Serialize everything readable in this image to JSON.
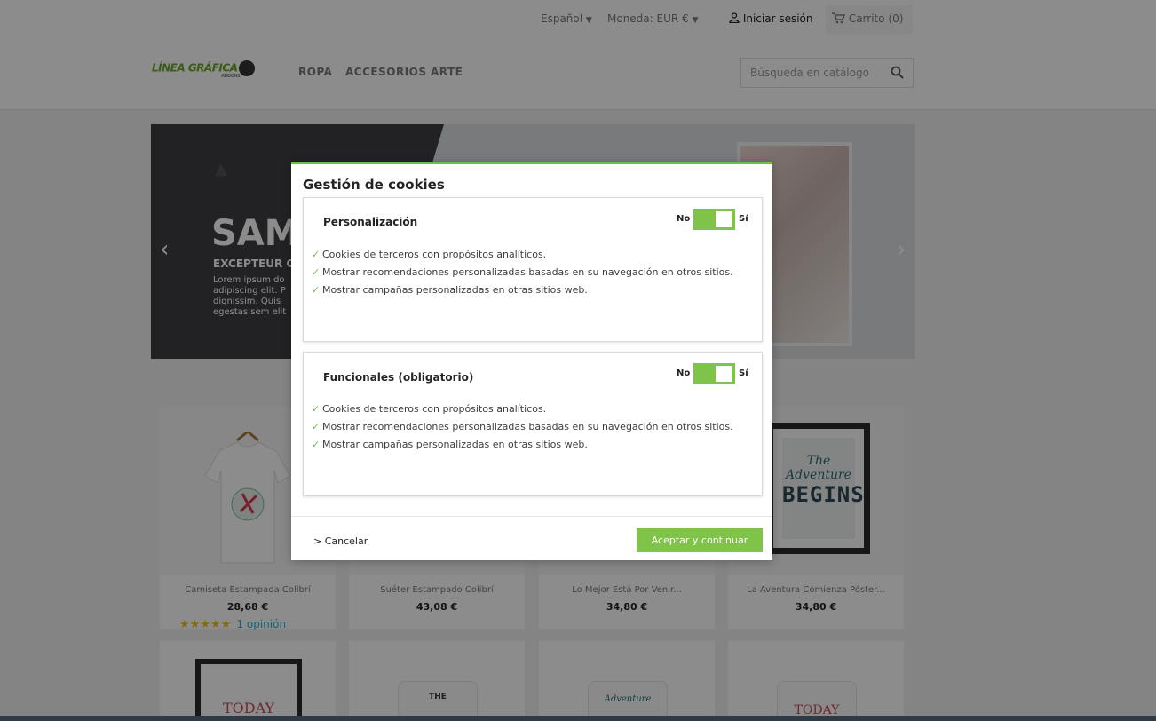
{
  "header": {
    "language": "Español",
    "currency": "Moneda: EUR €",
    "sign_in": "Iniciar sesión",
    "cart": "Carrito (0)",
    "logo_text": "LÍNEA GRÁFICA",
    "logo_small": "ADDONS",
    "menu": [
      "ROPA",
      "ACCESORIOS",
      "ARTE"
    ],
    "search_placeholder": "Búsqueda en catálogo"
  },
  "hero": {
    "title": "SAM",
    "subtitle": "EXCEPTEUR C",
    "text": "Lorem ipsum do adipiscing elit. P dignissim. Quis egestas sem elit"
  },
  "products": [
    {
      "name": "Camiseta Estampada Colibrí",
      "price": "28,68 €",
      "rating": 5,
      "reviews": "1 opinión"
    },
    {
      "name": "Suéter Estampado Colibrí",
      "price": "43,08 €"
    },
    {
      "name": "Lo Mejor Está Por Venir...",
      "price": "34,80 €"
    },
    {
      "name": "La Aventura Comienza Póster...",
      "price": "34,80 €"
    }
  ],
  "row2_labels": [
    "TODAY",
    "THE",
    "Adventure",
    "TODAY"
  ],
  "poster_text": {
    "small": "The Adventure",
    "big": "BEGINS"
  },
  "modal": {
    "title": "Gestión de cookies",
    "sections": [
      {
        "title": "Personalización",
        "toggle_no": "No",
        "toggle_yes": "Sí",
        "enabled": true,
        "items": [
          "Cookies de terceros con propósitos analíticos.",
          "Mostrar recomendaciones personalizadas basadas en su navegación en otros sitios.",
          "Mostrar campañas personalizadas en otras sitios web."
        ]
      },
      {
        "title": "Funcionales (obligatorio)",
        "toggle_no": "No",
        "toggle_yes": "Sí",
        "enabled": true,
        "items": [
          "Cookies de terceros con propósitos analíticos.",
          "Mostrar recomendaciones personalizadas basadas en su navegación en otros sitios.",
          "Mostrar campañas personalizadas en otras sitios web."
        ]
      }
    ],
    "cancel": "> Cancelar",
    "accept": "Aceptar y continuar"
  },
  "colors": {
    "accent_green": "#7fc449",
    "modal_border": "#6fbd46",
    "star": "#f0c419",
    "link": "#24b9d7"
  }
}
